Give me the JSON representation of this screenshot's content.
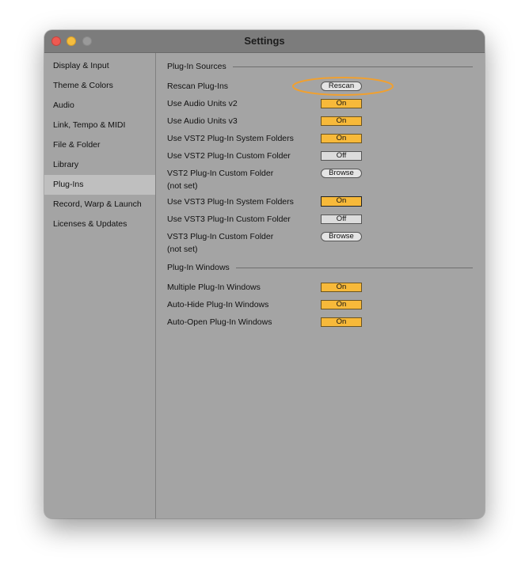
{
  "window": {
    "title": "Settings"
  },
  "sidebar": {
    "items": [
      {
        "label": "Display & Input"
      },
      {
        "label": "Theme & Colors"
      },
      {
        "label": "Audio"
      },
      {
        "label": "Link, Tempo & MIDI"
      },
      {
        "label": "File & Folder"
      },
      {
        "label": "Library"
      },
      {
        "label": "Plug-Ins",
        "selected": true
      },
      {
        "label": "Record, Warp & Launch"
      },
      {
        "label": "Licenses & Updates"
      }
    ]
  },
  "sources": {
    "heading": "Plug-In Sources",
    "rescan_label": "Rescan Plug-Ins",
    "rescan_button": "Rescan",
    "au2_label": "Use Audio Units v2",
    "au2_value": "On",
    "au3_label": "Use Audio Units v3",
    "au3_value": "On",
    "vst2_sys_label": "Use VST2 Plug-In System Folders",
    "vst2_sys_value": "On",
    "vst2_custom_label": "Use VST2 Plug-In Custom Folder",
    "vst2_custom_value": "Off",
    "vst2_folder_label": "VST2 Plug-In Custom Folder",
    "vst2_folder_value": "(not set)",
    "vst2_browse": "Browse",
    "vst3_sys_label": "Use VST3 Plug-In System Folders",
    "vst3_sys_value": "On",
    "vst3_custom_label": "Use VST3 Plug-In Custom Folder",
    "vst3_custom_value": "Off",
    "vst3_folder_label": "VST3 Plug-In Custom Folder",
    "vst3_folder_value": "(not set)",
    "vst3_browse": "Browse"
  },
  "windows": {
    "heading": "Plug-In Windows",
    "multiple_label": "Multiple Plug-In Windows",
    "multiple_value": "On",
    "autohide_label": "Auto-Hide Plug-In Windows",
    "autohide_value": "On",
    "autoopen_label": "Auto-Open Plug-In Windows",
    "autoopen_value": "On"
  },
  "colors": {
    "toggle_on": "#f7b93a",
    "toggle_off": "#dcdcdc",
    "highlight": "#f0a030",
    "window_bg": "#a4a4a4"
  }
}
